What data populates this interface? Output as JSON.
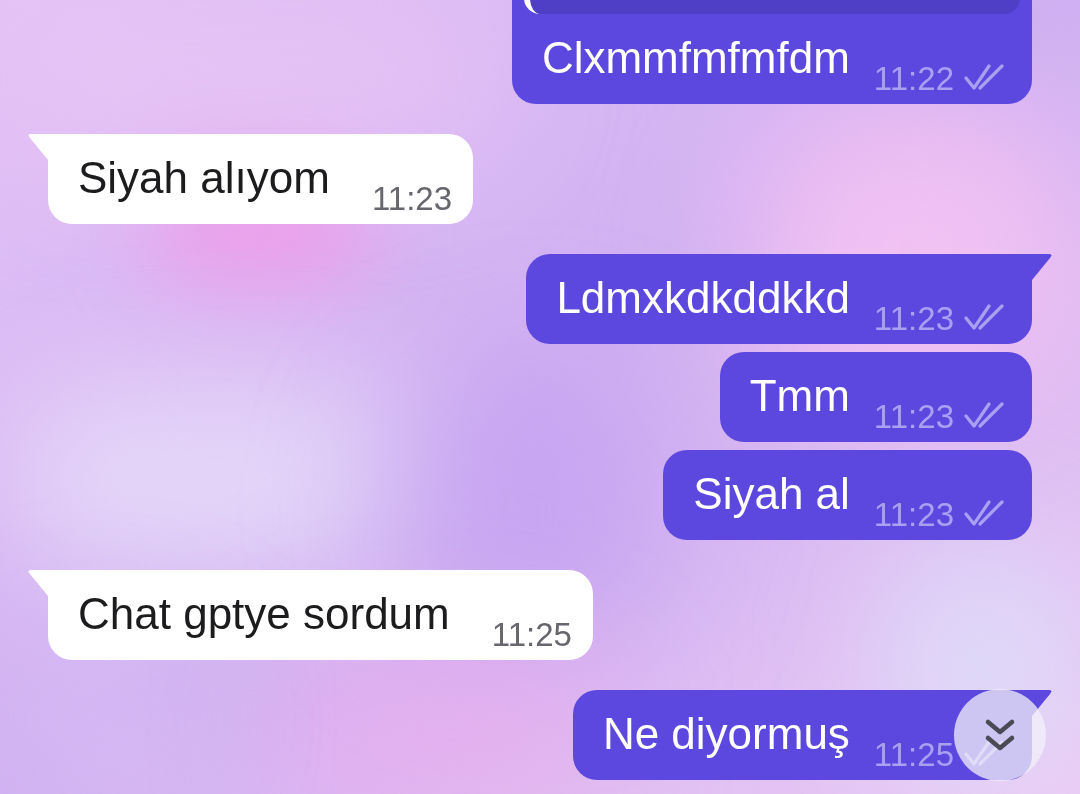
{
  "messages": [
    {
      "kind": "outgoing",
      "quoted": true,
      "text": "Clxmmfmfmfdm",
      "time": "11:22",
      "read": true
    },
    {
      "kind": "incoming",
      "text": "Siyah alıyom",
      "time": "11:23"
    },
    {
      "kind": "outgoing",
      "text": "Ldmxkdkddkkd",
      "time": "11:23",
      "read": true
    },
    {
      "kind": "outgoing",
      "text": "Tmm",
      "time": "11:23",
      "read": true
    },
    {
      "kind": "outgoing",
      "text": "Siyah al",
      "time": "11:23",
      "read": true
    },
    {
      "kind": "incoming",
      "text": "Chat gptye sordum",
      "time": "11:25"
    },
    {
      "kind": "outgoing",
      "text": "Ne diyormuş",
      "time": "11:25",
      "read": true
    }
  ]
}
